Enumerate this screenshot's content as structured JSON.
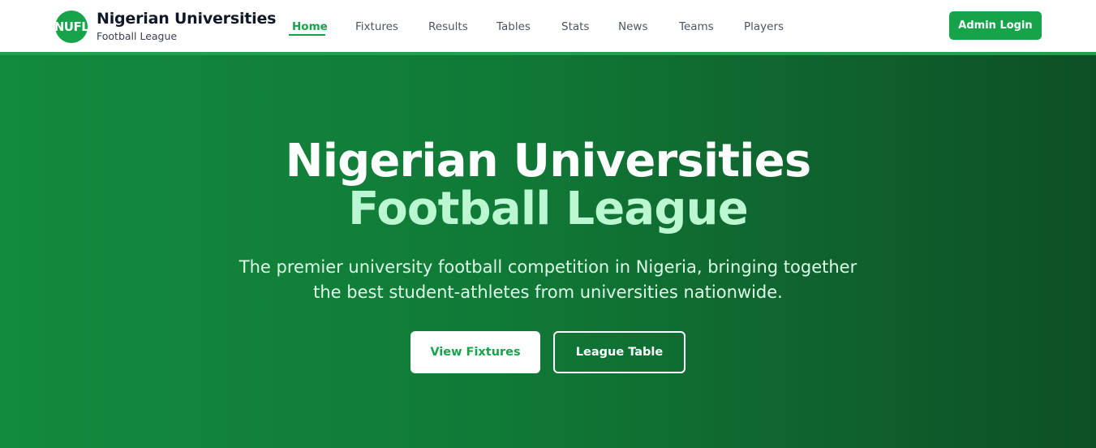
{
  "brand": {
    "logo_text": "NUFL",
    "title": "Nigerian Universities",
    "subtitle": "Football League"
  },
  "nav": {
    "items": [
      {
        "label": "Home",
        "active": true
      },
      {
        "label": "Fixtures",
        "active": false
      },
      {
        "label": "Results",
        "active": false
      },
      {
        "label": "Tables",
        "active": false
      },
      {
        "label": "Stats",
        "active": false
      },
      {
        "label": "News",
        "active": false
      },
      {
        "label": "Teams",
        "active": false
      },
      {
        "label": "Players",
        "active": false
      }
    ],
    "admin_label": "Admin Login"
  },
  "hero": {
    "title_line1": "Nigerian Universities",
    "title_line2": "Football League",
    "description": "The premier university football competition in Nigeria, bringing together the best student-athletes from universities nationwide.",
    "primary_cta": "View Fixtures",
    "secondary_cta": "League Table"
  },
  "colors": {
    "brand_green": "#16a34a",
    "hero_green_start": "#138a3e",
    "hero_green_end": "#0d4f25",
    "accent_light_green": "#bbf7d0"
  }
}
